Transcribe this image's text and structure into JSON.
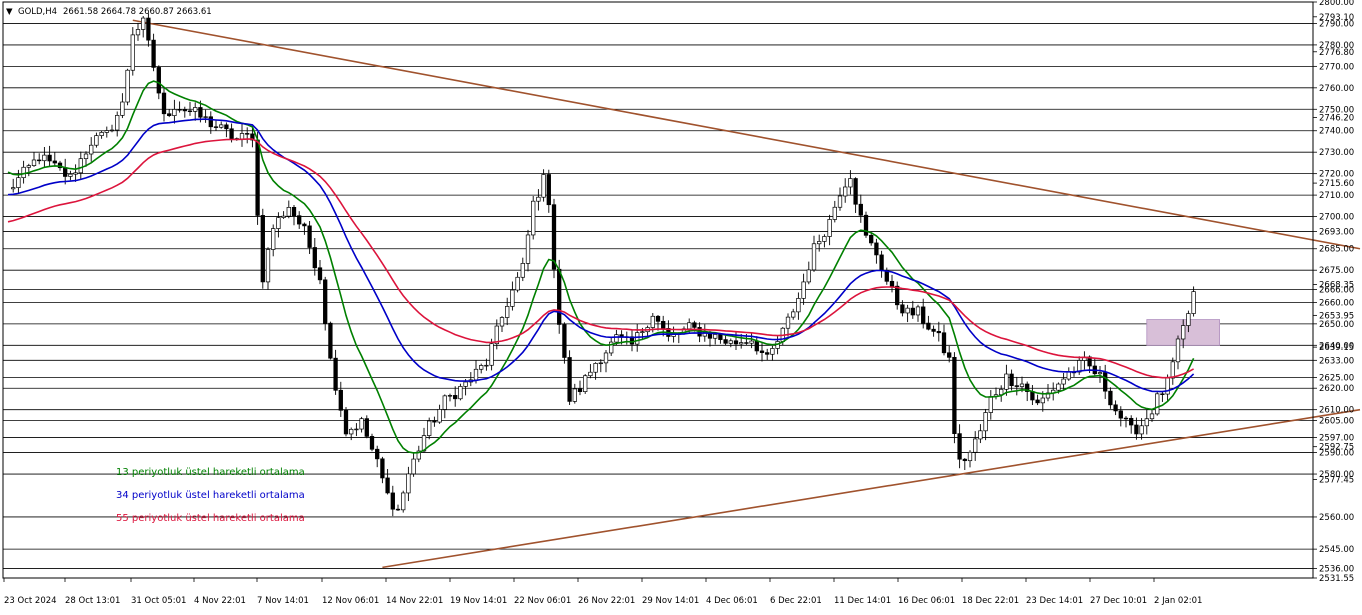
{
  "header": {
    "symbol": "GOLD,H4",
    "ohlc": "2661.58 2664.78 2660.87 2663.61"
  },
  "colors": {
    "background": "#ffffff",
    "frame": "#000000",
    "hline": "#000000",
    "trendline": "#a0522d",
    "ema13": "#008000",
    "ema34": "#0000c8",
    "ema55": "#dc143c",
    "zone": "#d8bfd8",
    "candle": "#000000"
  },
  "legend": [
    {
      "label": "13 periyotluk üstel hareketli ortalama",
      "color": "#008000"
    },
    {
      "label": "34 periyotluk üstel hareketli ortalama",
      "color": "#0000c8"
    },
    {
      "label": "55 periyotluk üstel hareketli ortalama",
      "color": "#dc143c"
    }
  ],
  "chart_data": {
    "type": "candlestick",
    "title": "",
    "xlabel": "",
    "ylabel": "",
    "ylim": [
      2531.55,
      2800.0
    ],
    "yticks": [
      "2800.00",
      "2793.10",
      "2790.00",
      "2780.00",
      "2776.80",
      "2770.00",
      "2760.00",
      "2750.00",
      "2746.20",
      "2740.00",
      "2730.00",
      "2720.00",
      "2715.60",
      "2710.00",
      "2700.00",
      "2693.00",
      "2685.00",
      "2675.00",
      "2668.35",
      "2666.00",
      "2660.00",
      "2653.95",
      "2650.00",
      "2640.00",
      "2639.15",
      "2633.00",
      "2625.00",
      "2620.00",
      "2610.00",
      "2605.00",
      "2597.00",
      "2592.75",
      "2590.00",
      "2580.00",
      "2577.45",
      "2560.00",
      "2545.00",
      "2536.00",
      "2531.55"
    ],
    "horizontal_levels": [
      2790.0,
      2780.0,
      2770.0,
      2760.0,
      2750.0,
      2740.0,
      2730.0,
      2720.0,
      2710.0,
      2700.0,
      2693.0,
      2685.0,
      2675.0,
      2666.0,
      2660.0,
      2650.0,
      2640.0,
      2633.0,
      2625.0,
      2620.0,
      2610.0,
      2605.0,
      2597.0,
      2590.0,
      2580.0,
      2560.0,
      2545.0,
      2536.0
    ],
    "xticks": [
      "23 Oct 2024",
      "28 Oct 13:01",
      "31 Oct 05:01",
      "4 Nov 22:01",
      "7 Nov 14:01",
      "12 Nov 06:01",
      "14 Nov 22:01",
      "19 Nov 14:01",
      "22 Nov 06:01",
      "26 Nov 22:01",
      "29 Nov 14:01",
      "4 Dec 06:01",
      "6 Dec 22:01",
      "11 Dec 14:01",
      "16 Dec 06:01",
      "18 Dec 22:01",
      "23 Dec 14:01",
      "27 Dec 10:01",
      "2 Jan 02:01"
    ],
    "price_path": [
      [
        0,
        2712
      ],
      [
        6,
        2728
      ],
      [
        12,
        2718
      ],
      [
        16,
        2735
      ],
      [
        19,
        2738
      ],
      [
        22,
        2752
      ],
      [
        24,
        2786
      ],
      [
        26,
        2790
      ],
      [
        28,
        2770
      ],
      [
        30,
        2746
      ],
      [
        32,
        2752
      ],
      [
        36,
        2748
      ],
      [
        40,
        2742
      ],
      [
        44,
        2736
      ],
      [
        47,
        2738
      ],
      [
        48,
        2700
      ],
      [
        49,
        2672
      ],
      [
        51,
        2695
      ],
      [
        54,
        2705
      ],
      [
        57,
        2693
      ],
      [
        60,
        2672
      ],
      [
        62,
        2633
      ],
      [
        65,
        2600
      ],
      [
        68,
        2604
      ],
      [
        71,
        2585
      ],
      [
        73,
        2570
      ],
      [
        75,
        2563
      ],
      [
        77,
        2580
      ],
      [
        80,
        2598
      ],
      [
        84,
        2614
      ],
      [
        88,
        2622
      ],
      [
        92,
        2632
      ],
      [
        96,
        2660
      ],
      [
        99,
        2676
      ],
      [
        101,
        2706
      ],
      [
        103,
        2717
      ],
      [
        104,
        2708
      ],
      [
        105,
        2677
      ],
      [
        106,
        2650
      ],
      [
        108,
        2615
      ],
      [
        110,
        2620
      ],
      [
        113,
        2632
      ],
      [
        117,
        2643
      ],
      [
        120,
        2640
      ],
      [
        124,
        2655
      ],
      [
        127,
        2643
      ],
      [
        131,
        2648
      ],
      [
        135,
        2645
      ],
      [
        139,
        2641
      ],
      [
        143,
        2643
      ],
      [
        146,
        2633
      ],
      [
        149,
        2646
      ],
      [
        152,
        2662
      ],
      [
        155,
        2685
      ],
      [
        158,
        2698
      ],
      [
        160,
        2712
      ],
      [
        162,
        2720
      ],
      [
        163,
        2708
      ],
      [
        165,
        2690
      ],
      [
        167,
        2683
      ],
      [
        169,
        2670
      ],
      [
        171,
        2660
      ],
      [
        173,
        2655
      ],
      [
        175,
        2655
      ],
      [
        177,
        2649
      ],
      [
        179,
        2643
      ],
      [
        181,
        2633
      ],
      [
        182,
        2600
      ],
      [
        183,
        2585
      ],
      [
        185,
        2590
      ],
      [
        187,
        2600
      ],
      [
        189,
        2615
      ],
      [
        192,
        2625
      ],
      [
        195,
        2622
      ],
      [
        198,
        2612
      ],
      [
        201,
        2620
      ],
      [
        204,
        2627
      ],
      [
        207,
        2632
      ],
      [
        210,
        2625
      ],
      [
        213,
        2610
      ],
      [
        216,
        2600
      ],
      [
        218,
        2603
      ],
      [
        220,
        2610
      ],
      [
        221,
        2615
      ],
      [
        223,
        2622
      ],
      [
        225,
        2640
      ],
      [
        227,
        2655
      ],
      [
        228,
        2664
      ]
    ],
    "candle_count": 228,
    "series": [
      {
        "name": "13 periyotluk üstel hareketli ortalama",
        "period": 13
      },
      {
        "name": "34 periyotluk üstel hareketli ortalama",
        "period": 34
      },
      {
        "name": "55 periyotluk üstel hareketli ortalama",
        "period": 55
      }
    ],
    "ema_seed": {
      "ema13": 2722,
      "ema34": 2710,
      "ema55": 2697
    },
    "trendlines": [
      {
        "from": [
          24,
          2791.5
        ],
        "to": [
          260,
          2685.0
        ]
      },
      {
        "from": [
          72,
          2536.5
        ],
        "to": [
          260,
          2610.0
        ]
      }
    ],
    "zone": {
      "x_start": 219,
      "x_end": 233,
      "y_low": 2640,
      "y_high": 2652
    }
  }
}
